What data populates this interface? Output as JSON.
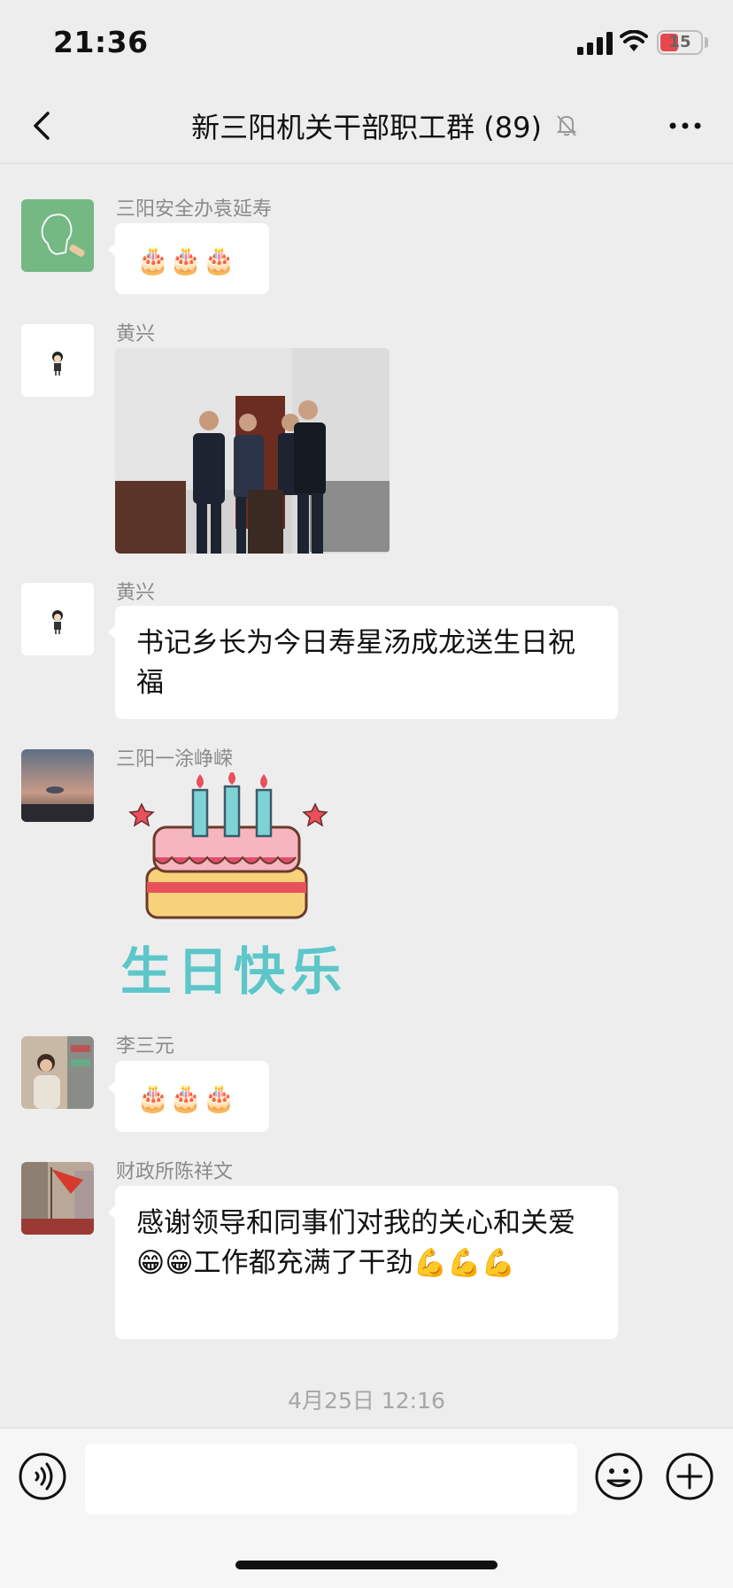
{
  "status_bar": {
    "time": "21:36",
    "battery": "15"
  },
  "header": {
    "title": "新三阳机关干部职工群 (89)"
  },
  "messages": [
    {
      "sender": "三阳安全办袁延寿",
      "content": "🎂🎂🎂"
    },
    {
      "sender": "黄兴",
      "type": "image"
    },
    {
      "sender": "黄兴",
      "content": "书记乡长为今日寿星汤成龙送生日祝福"
    },
    {
      "sender": "三阳一涂峥嵘",
      "sticker_text": "生日快乐"
    },
    {
      "sender": "李三元",
      "content": "🎂🎂🎂"
    },
    {
      "sender": "财政所陈祥文",
      "content": "感谢领导和同事们对我的关心和关爱 😁😁工作都充满了干劲💪💪💪"
    }
  ],
  "timestamp": "4月25日 12:16",
  "colors": {
    "background": "#ededed",
    "bubble": "#ffffff",
    "sticker_text": "#5ec6c9"
  }
}
